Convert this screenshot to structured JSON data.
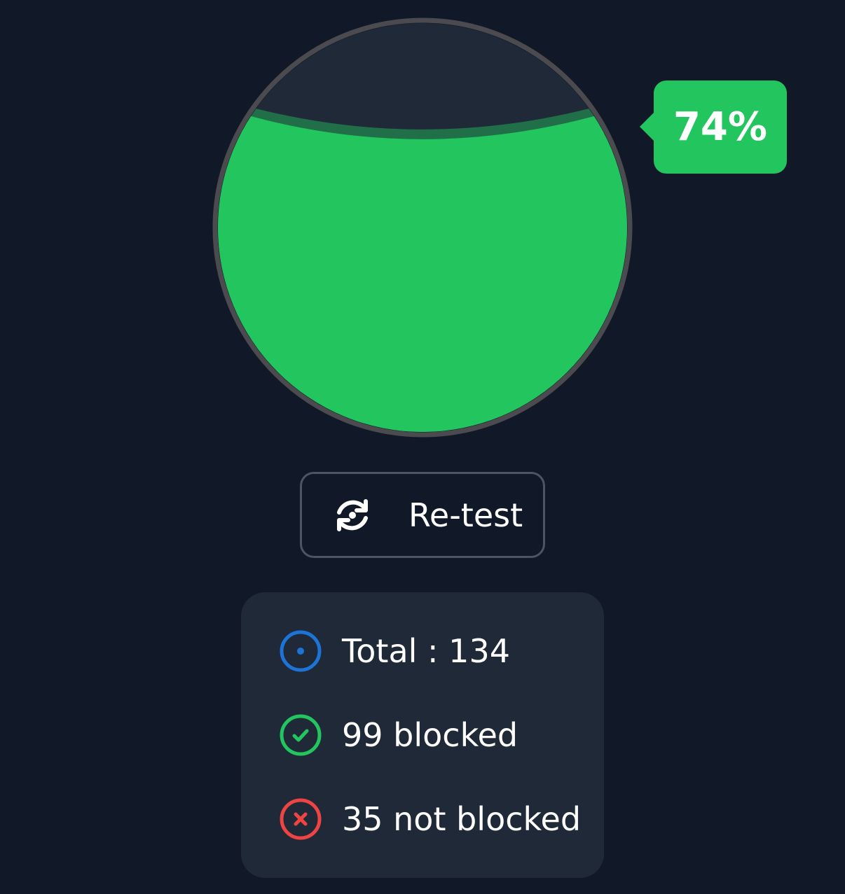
{
  "gauge": {
    "fill_fraction": 0.74,
    "percent_label": "74%",
    "colors": {
      "fill": "#22c55e",
      "empty": "#1f2937",
      "ring": "#4b4b4f"
    }
  },
  "retest_button": {
    "label": "Re-test",
    "icon": "refresh-icon"
  },
  "stats": {
    "total_label": "Total : 134",
    "blocked_label": "99 blocked",
    "not_blocked_label": "35 not blocked",
    "colors": {
      "total": "#1d74d6",
      "blocked": "#22c55e",
      "not_blocked": "#ef4444"
    },
    "icons": {
      "total": "target-circle-icon",
      "blocked": "check-circle-icon",
      "not_blocked": "x-circle-icon"
    }
  }
}
